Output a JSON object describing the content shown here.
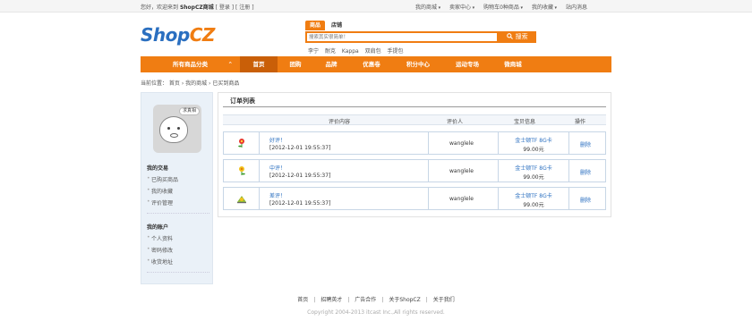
{
  "topbar": {
    "welcome_prefix": "您好，欢迎来到",
    "site_name": "ShopCZ商城",
    "login": "[ 登录 ]",
    "register": "[ 注册 ]",
    "links": [
      "我的商城",
      "卖家中心",
      "购物车0种商品",
      "我的收藏",
      "站内消息"
    ]
  },
  "logo": {
    "part1": "Shop",
    "part2": "CZ"
  },
  "search": {
    "tabs": [
      "商品",
      "店铺"
    ],
    "placeholder": "搜索其实很简单！",
    "button": "搜索",
    "hot_words": [
      "李宁",
      "耐克",
      "Kappa",
      "双肩包",
      "手提包"
    ]
  },
  "nav": {
    "all_label": "所有商品分类",
    "items": [
      "首页",
      "团购",
      "品牌",
      "优惠卷",
      "积分中心",
      "运动专场",
      "微商城"
    ]
  },
  "breadcrumb": "当前位置： 首页 › 我的商城 › 已买到商品",
  "sidebar": {
    "avatar_tag": "求真相",
    "section1_title": "我的交易",
    "section1_items": [
      "已购买商品",
      "我的收藏",
      "评价管理"
    ],
    "section2_title": "我的账户",
    "section2_items": [
      "个人资料",
      "密码修改",
      "收货地址"
    ]
  },
  "main": {
    "title": "订单列表",
    "columns": [
      "评价内容",
      "评价人",
      "宝贝信息",
      "操作"
    ],
    "rows": [
      {
        "icon": "good-flower-icon",
        "title": "好评！",
        "time": "[2012-12-01 19:55:37]",
        "user": "wanglele",
        "product": "金士顿TF 8G卡",
        "price": "99.00元",
        "action": "删除"
      },
      {
        "icon": "medium-flower-icon",
        "title": "中评！",
        "time": "[2012-12-01 19:55:37]",
        "user": "wanglele",
        "product": "金士顿TF 8G卡",
        "price": "99.00元",
        "action": "删除"
      },
      {
        "icon": "bad-flower-icon",
        "title": "差评！",
        "time": "[2012-12-01 19:55:37]",
        "user": "wanglele",
        "product": "金士顿TF 8G卡",
        "price": "99.00元",
        "action": "删除"
      }
    ]
  },
  "footer": {
    "links": [
      "首页",
      "招聘英才",
      "广告合作",
      "关于ShopCZ",
      "关于我们"
    ],
    "copyright": "Copyright 2004-2013 itcast Inc.,All rights reserved."
  },
  "colors": {
    "accent": "#f07d12",
    "link": "#2a6fc0"
  }
}
